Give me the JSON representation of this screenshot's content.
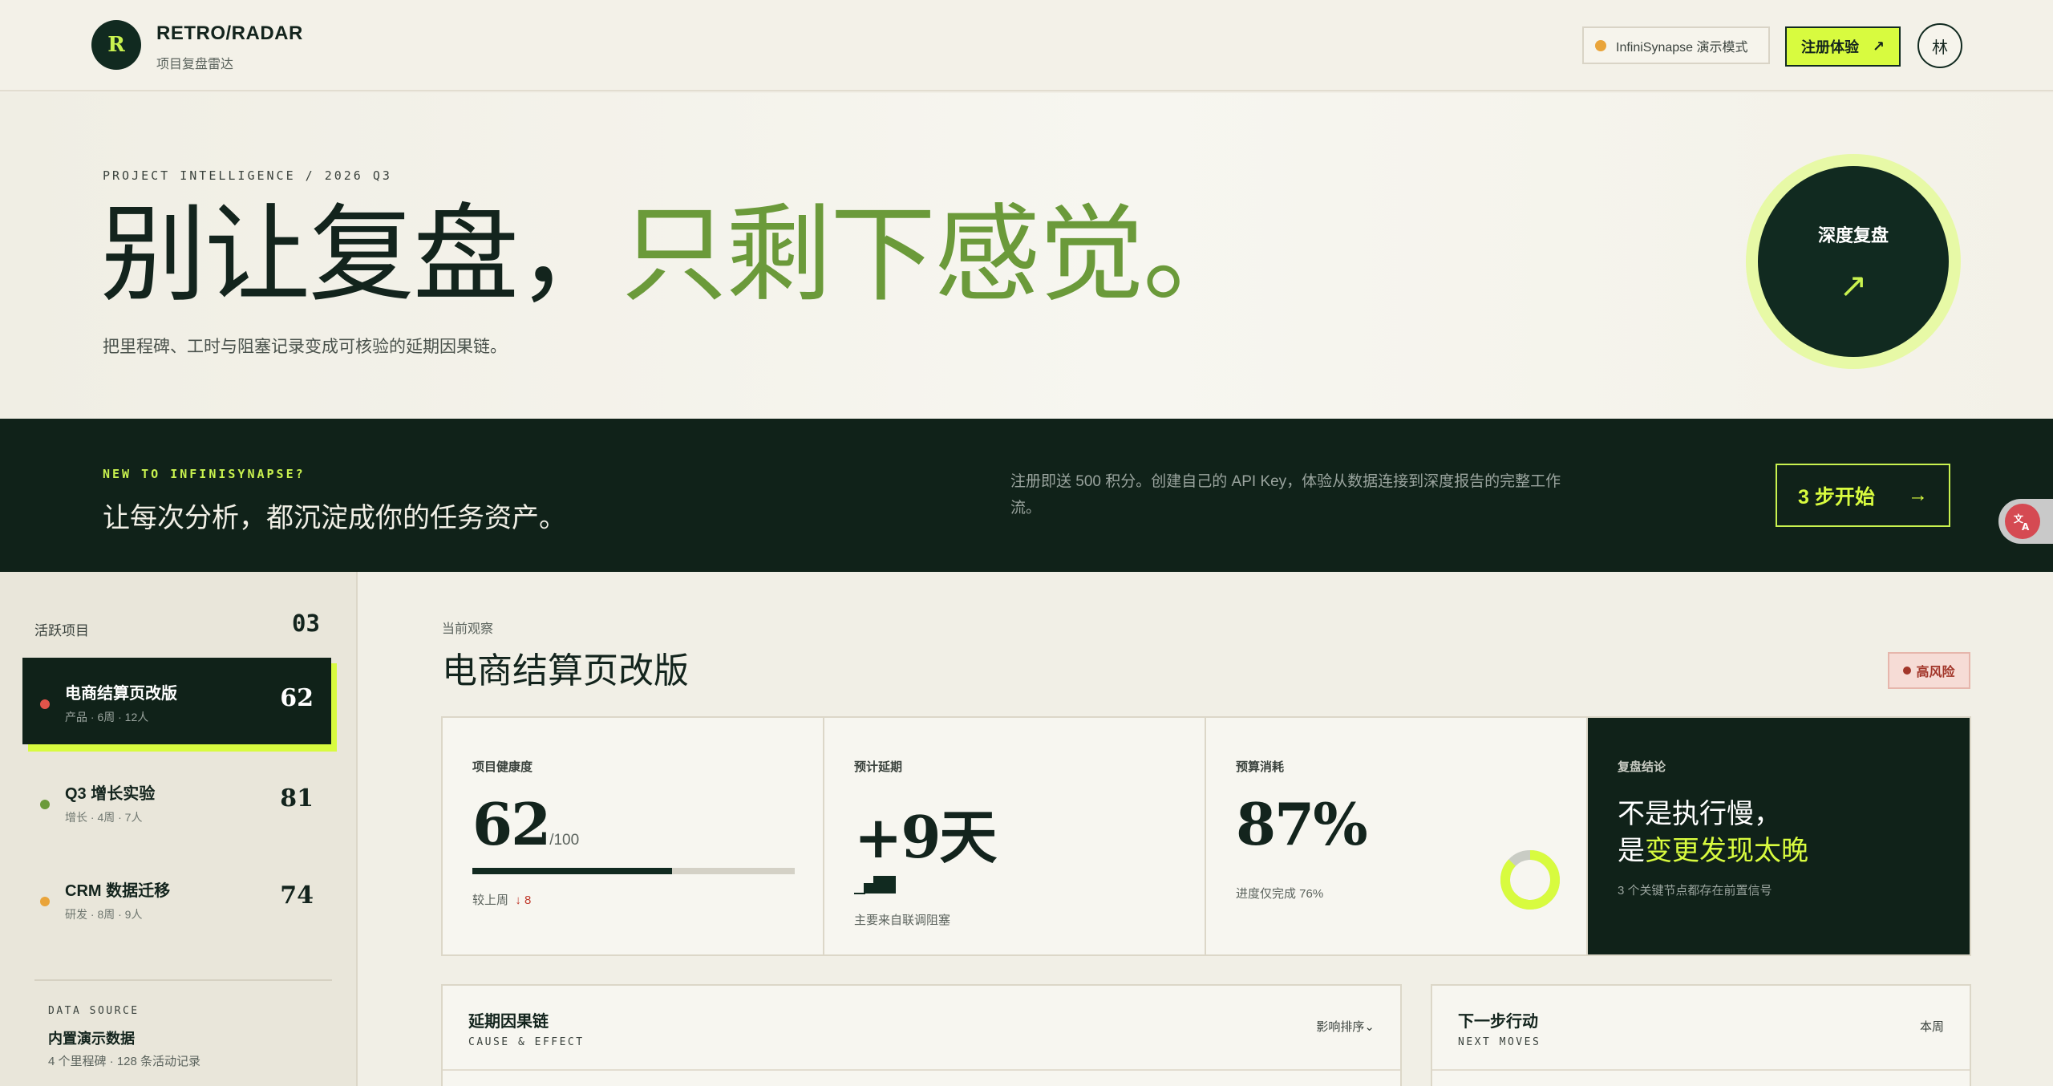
{
  "brand": {
    "logo_letter": "R",
    "name": "RETRO/RADAR",
    "subtitle": "项目复盘雷达"
  },
  "topbar": {
    "demo_label": "InfiniSynapse 演示模式",
    "signup_label": "注册体验",
    "signup_icon": "↗",
    "avatar_text": "林"
  },
  "hero": {
    "kicker": "PROJECT INTELLIGENCE / 2026 Q3",
    "title_main": "别让复盘，",
    "title_accent": "只剩下感觉。",
    "subtitle": "把里程碑、工时与阻塞记录变成可核验的延期因果链。",
    "deep_label": "深度复盘",
    "deep_icon": "↗"
  },
  "banner": {
    "kicker": "NEW TO INFINISYNAPSE?",
    "title": "让每次分析，都沉淀成你的任务资产。",
    "description": "注册即送 500 积分。创建自己的 API Key，体验从数据连接到深度报告的完整工作流。",
    "cta_label": "3 步开始",
    "cta_icon": "→"
  },
  "sidebar": {
    "header_label": "活跃项目",
    "header_count": "03",
    "projects": [
      {
        "name": "电商结算页改版",
        "meta": "产品 · 6周 · 12人",
        "score": "62",
        "dot_color": "#e0544a",
        "active": true
      },
      {
        "name": "Q3 增长实验",
        "meta": "增长 · 4周 · 7人",
        "score": "81",
        "dot_color": "#6b9a3a",
        "active": false
      },
      {
        "name": "CRM 数据迁移",
        "meta": "研发 · 8周 · 9人",
        "score": "74",
        "dot_color": "#e9a43a",
        "active": false
      }
    ],
    "data_source": {
      "kicker": "DATA SOURCE",
      "title": "内置演示数据",
      "meta": "4 个里程碑 · 128 条活动记录"
    }
  },
  "main": {
    "observing_label": "当前观察",
    "project_title": "电商结算页改版",
    "risk_label": "高风险",
    "kpis": {
      "health": {
        "label": "项目健康度",
        "value": "62",
        "unit": "/100",
        "progress": 0.62,
        "foot_prefix": "较上周",
        "delta": "↓ 8"
      },
      "delay": {
        "label": "预计延期",
        "value": "+9天",
        "foot": "主要来自联调阻塞"
      },
      "budget": {
        "label": "预算消耗",
        "value": "87%",
        "foot": "进度仅完成 76%",
        "donut_fraction": 0.87
      },
      "conclusion": {
        "label": "复盘结论",
        "line1": "不是执行慢，",
        "line2_prefix": "是",
        "line2_highlight": "变更发现太晚",
        "foot": "3 个关键节点都存在前置信号"
      }
    },
    "cards": {
      "cause": {
        "title": "延期因果链",
        "subtitle": "CAUSE & EFFECT",
        "action": "影响排序⌄"
      },
      "next": {
        "title": "下一步行动",
        "subtitle": "NEXT MOVES",
        "action": "本周"
      }
    }
  },
  "colors": {
    "accent": "#d8fb3f",
    "dark": "#102219",
    "green": "#6b9a3a",
    "risk": "#a2362a"
  }
}
